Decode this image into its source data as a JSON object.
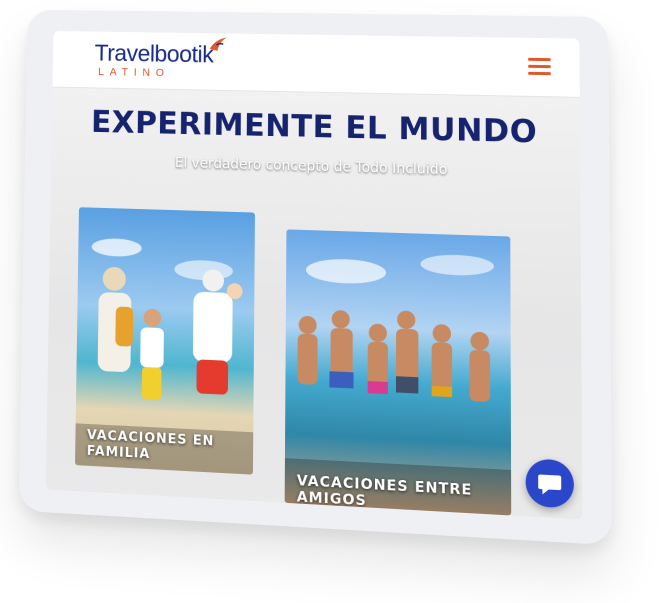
{
  "header": {
    "logo_main": "Travelbootik",
    "logo_sub": "LATINO",
    "menu_icon": "hamburger-menu-icon"
  },
  "hero": {
    "title": "EXPERIMENTE EL MUNDO",
    "subtitle": "El verdadero concepto de Todo Incluido"
  },
  "cards": [
    {
      "label": "VACACIONES EN FAMILIA"
    },
    {
      "label": "VACACIONES ENTRE AMIGOS"
    }
  ],
  "chat": {
    "icon": "chat-icon"
  },
  "colors": {
    "brand_navy": "#16236f",
    "accent_orange": "#e2582a",
    "chat_blue": "#2a46c9"
  }
}
